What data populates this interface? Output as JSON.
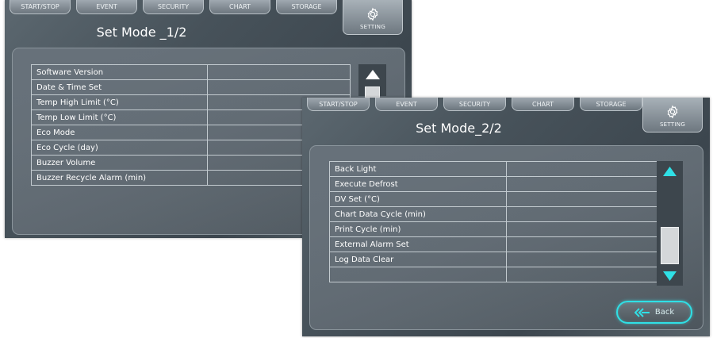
{
  "tabs": [
    "START/STOP",
    "EVENT",
    "SECURITY",
    "CHART",
    "STORAGE"
  ],
  "setting_label": "SETTING",
  "screen1": {
    "title": "Set Mode _1/2",
    "rows": [
      {
        "label": "Software Version",
        "value": ""
      },
      {
        "label": "Date & Time Set",
        "value": ""
      },
      {
        "label": "Temp High Limit (°C)",
        "value": ""
      },
      {
        "label": "Temp Low Limit (°C)",
        "value": ""
      },
      {
        "label": "Eco Mode",
        "value": ""
      },
      {
        "label": "Eco Cycle (day)",
        "value": ""
      },
      {
        "label": "Buzzer Volume",
        "value": ""
      },
      {
        "label": "Buzzer Recycle Alarm (min)",
        "value": ""
      }
    ]
  },
  "screen2": {
    "title": "Set Mode_2/2",
    "rows": [
      {
        "label": "Back Light",
        "value": ""
      },
      {
        "label": "Execute Defrost",
        "value": ""
      },
      {
        "label": "DV Set (°C)",
        "value": ""
      },
      {
        "label": "Chart Data Cycle (min)",
        "value": ""
      },
      {
        "label": "Print Cycle (min)",
        "value": ""
      },
      {
        "label": "External Alarm Set",
        "value": ""
      },
      {
        "label": "Log Data Clear",
        "value": ""
      },
      {
        "label": "",
        "value": ""
      }
    ],
    "back_label": "Back"
  },
  "icons": {
    "setting": "gear-icon",
    "scroll_up": "arrow-up-icon",
    "scroll_down": "arrow-down-icon",
    "back": "back-arrow-icon"
  },
  "colors": {
    "accent": "#2fe0e6",
    "background": "#47525a"
  }
}
